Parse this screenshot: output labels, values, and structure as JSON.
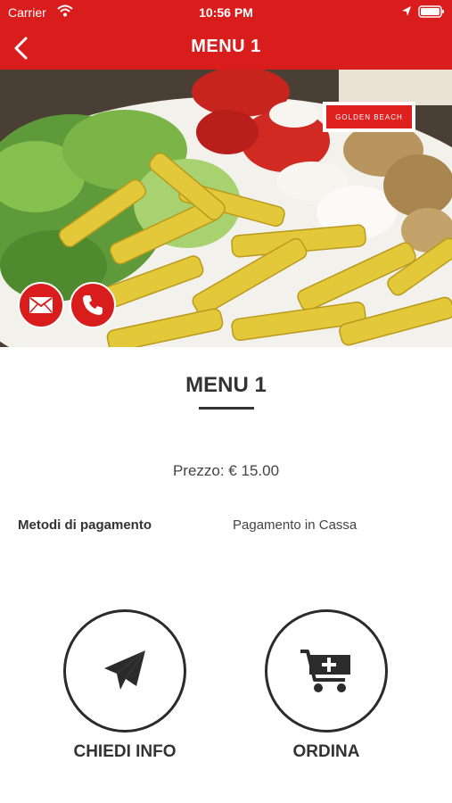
{
  "status_bar": {
    "carrier": "Carrier",
    "time": "10:56 PM"
  },
  "nav": {
    "title": "MENU 1",
    "back_icon": "chevron-left-icon"
  },
  "hero": {
    "image_alt": "Piatto di penne con insalata, pomodori, mozzarella e patate",
    "logo_text": "GOLDEN BEACH",
    "contact_icons": [
      "mail-icon",
      "phone-icon"
    ]
  },
  "product": {
    "title": "MENU 1",
    "price_text": "Prezzo: € 15.00",
    "payment_label": "Metodi di pagamento",
    "payment_value": "Pagamento in Cassa"
  },
  "actions": {
    "info_label": "CHIEDI INFO",
    "order_label": "ORDINA",
    "info_icon": "paper-plane-icon",
    "order_icon": "cart-plus-icon"
  },
  "colors": {
    "accent": "#d91d1d",
    "text_dark": "#333333"
  }
}
